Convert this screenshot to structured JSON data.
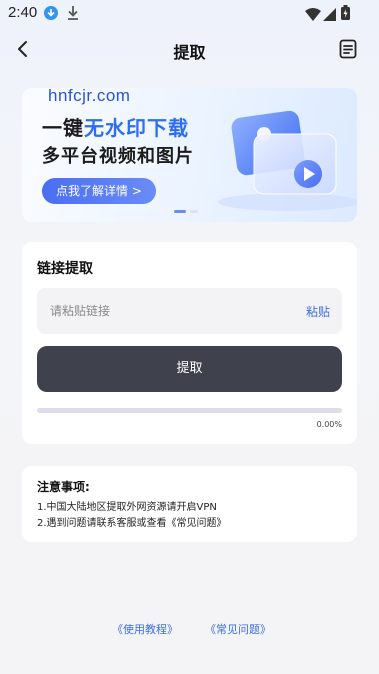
{
  "status_bar": {
    "time": "2:40"
  },
  "nav": {
    "title": "提取"
  },
  "banner": {
    "line1_prefix": "一键",
    "line1_highlight": "无水印下载",
    "line2": "多平台视频和图片",
    "button_label": "点我了解详情 >"
  },
  "extract_card": {
    "title": "链接提取",
    "input_placeholder": "请粘贴链接",
    "input_value": "",
    "paste_label": "粘贴",
    "extract_label": "提取",
    "progress_label": "0.00%",
    "progress": 0
  },
  "watermark": "hnfcjr.com",
  "notes": {
    "title": "注意事项:",
    "lines": [
      "1.中国大陆地区提取外网资源请开启VPN",
      "2.遇到问题请联系客服或查看《常见问题》"
    ]
  },
  "footer": {
    "tutorial_label": "《使用教程》",
    "faq_label": "《常见问题》"
  },
  "colors": {
    "accent": "#3a6ee8",
    "dark_button": "#3f424d",
    "highlight": "#2d6ef0"
  }
}
